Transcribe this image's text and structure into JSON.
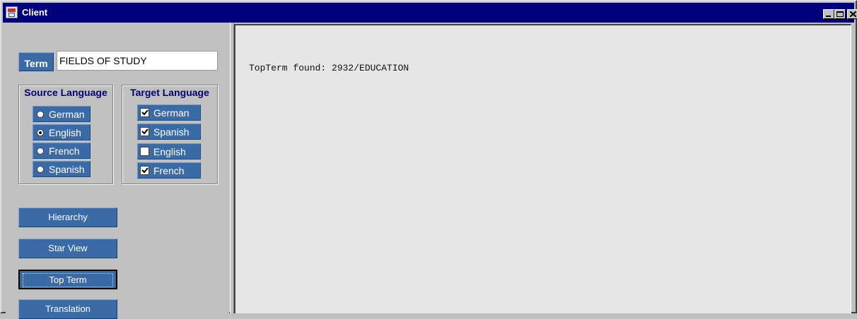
{
  "window": {
    "title": "Client"
  },
  "term": {
    "label": "Term",
    "value": "FIELDS OF STUDY"
  },
  "source_language": {
    "title": "Source Language",
    "options": [
      {
        "label": "German",
        "selected": false
      },
      {
        "label": "English",
        "selected": true
      },
      {
        "label": "French",
        "selected": false
      },
      {
        "label": "Spanish",
        "selected": false
      }
    ]
  },
  "target_language": {
    "title": "Target Language",
    "options": [
      {
        "label": "German",
        "checked": true
      },
      {
        "label": "Spanish",
        "checked": true
      },
      {
        "label": "English",
        "checked": false
      },
      {
        "label": "French",
        "checked": true
      }
    ]
  },
  "actions": {
    "hierarchy": "Hierarchy",
    "star_view": "Star View",
    "top_term": "Top Term",
    "translation": "Translation"
  },
  "output": {
    "text": "TopTerm found: 2932/EDUCATION"
  },
  "colors": {
    "titlebar": "#00007c",
    "button": "#3b6ba7",
    "panel": "#c0c0c0",
    "output_bg": "#e6e6e6"
  }
}
